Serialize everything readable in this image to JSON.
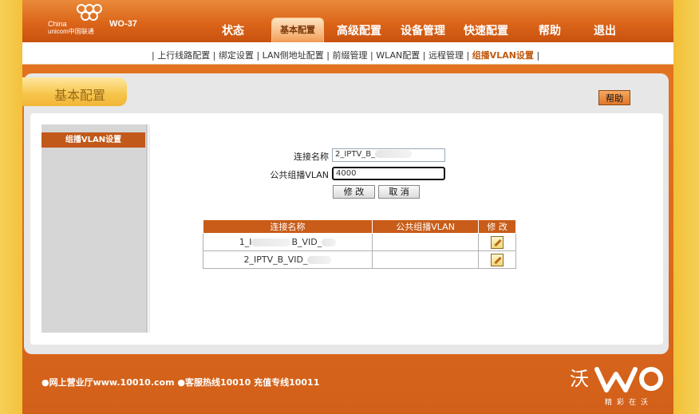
{
  "brand": {
    "line1": "China",
    "line2": "unicom中国联通",
    "model": "WO-37"
  },
  "nav": {
    "items": [
      "状态",
      "基本配置",
      "高级配置",
      "设备管理",
      "快速配置",
      "帮助",
      "退出"
    ],
    "active_index": 1
  },
  "subnav": {
    "items": [
      "上行线路配置",
      "绑定设置",
      "LAN侧地址配置",
      "前缀管理",
      "WLAN配置",
      "远程管理",
      "组播VLAN设置"
    ],
    "current": "组播VLAN设置",
    "separator": "|"
  },
  "page": {
    "title": "基本配置",
    "help_label": "帮助"
  },
  "sidebar": {
    "items": [
      "组播VLAN设置"
    ]
  },
  "form": {
    "conn_name_label": "连接名称",
    "conn_name_value": "2_IPTV_B_",
    "vlan_label": "公共组播VLAN",
    "vlan_value": "4000",
    "modify_label": "修 改",
    "cancel_label": "取 消"
  },
  "table": {
    "headers": [
      "连接名称",
      "公共组播VLAN",
      "修 改"
    ],
    "rows": [
      {
        "name_prefix": "1_I",
        "name_mid": "B_VID_",
        "vlan": ""
      },
      {
        "name_prefix": "2_IPTV_B_VID_",
        "name_mid": "",
        "vlan": ""
      }
    ]
  },
  "footer": {
    "text": "●网上营业厅www.10010.com ●客服热线10010 充值专线10011",
    "slogan": "精彩在沃",
    "logo": "沃"
  },
  "colors": {
    "brand_orange": "#dd6a1d",
    "accent": "#c85c18",
    "side_yellow": "#f3c23a"
  }
}
